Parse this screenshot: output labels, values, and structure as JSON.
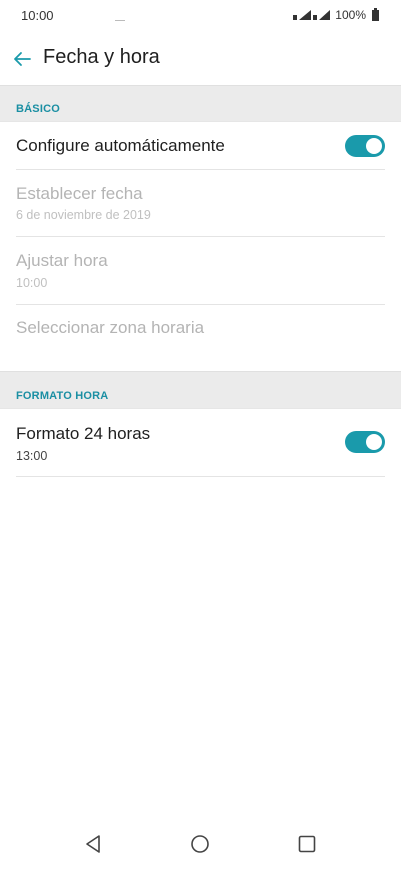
{
  "status_bar": {
    "time": "10:00",
    "battery_text": "100%"
  },
  "app_bar": {
    "title": "Fecha y hora",
    "back_icon": "arrow-left-icon"
  },
  "sections": {
    "basic": {
      "header": "BÁSICO",
      "auto_config": {
        "title": "Configure automáticamente",
        "toggle_on": true
      },
      "set_date": {
        "title": "Establecer fecha",
        "subtitle": "6 de noviembre de 2019",
        "enabled": false
      },
      "set_time": {
        "title": "Ajustar hora",
        "subtitle": "10:00",
        "enabled": false
      },
      "timezone": {
        "title": "Seleccionar zona horaria",
        "enabled": false
      }
    },
    "time_format": {
      "header": "FORMATO HORA",
      "format_24": {
        "title": "Formato 24 horas",
        "subtitle": "13:00",
        "toggle_on": true
      }
    }
  },
  "nav_bar": {
    "back": "triangle-back-icon",
    "home": "circle-home-icon",
    "recents": "square-recents-icon"
  },
  "colors": {
    "accent": "#1a9aab",
    "section_header_text": "#1a8fa3",
    "section_header_bg": "#ebebeb"
  }
}
